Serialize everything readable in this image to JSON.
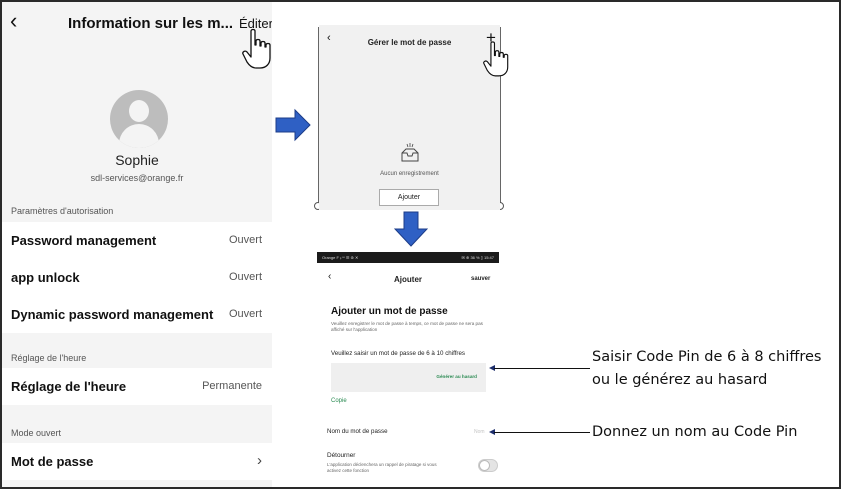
{
  "left_screen": {
    "title": "Information sur les m...",
    "edit_label": "Éditer",
    "user_name": "Sophie",
    "user_email": "sdl-services@orange.fr",
    "sections": [
      {
        "header": "Paramètres d'autorisation"
      },
      {
        "header": "Réglage de l'heure"
      },
      {
        "header": "Mode ouvert"
      }
    ],
    "rows": [
      {
        "label": "Password management",
        "value": "Ouvert"
      },
      {
        "label": "app unlock",
        "value": "Ouvert"
      },
      {
        "label": "Dynamic password management",
        "value": "Ouvert"
      },
      {
        "label": "Réglage de l'heure",
        "value": "Permanente"
      },
      {
        "label": "Mot de passe",
        "value": ""
      }
    ]
  },
  "manage_screen": {
    "title": "Gérer le mot de passe",
    "empty_text": "Aucun enregistrement",
    "add_button": "Ajouter"
  },
  "add_screen": {
    "status_left": "Orange F ᵢₗ ᵚ ☰ ⊛ ✕",
    "status_right": "✉ ⊕ 36 % ▯ 15:47",
    "title": "Ajouter",
    "save_label": "sauver",
    "heading": "Ajouter un mot de passe",
    "description": "Veuillez enregistrer le mot de passe à temps, ce mot de passe ne sera pas affiché sur l'application",
    "input_label": "Veuillez saisir un mot de passe de 6 à 10 chiffres",
    "generate_label": "Générer au hasard",
    "copy_label": "Copie",
    "name_label": "Nom du mot de passe",
    "name_placeholder": "Nom",
    "divert_label": "Détourner",
    "divert_description": "L'application déclenchera un rappel de piratage si vous activez cette fonction"
  },
  "annotations": {
    "pin_line1": "Saisir Code Pin de 6 à 8 chiffres",
    "pin_line2": "ou le générez au hasard",
    "name_text": "Donnez un nom au Code Pin"
  },
  "colors": {
    "arrow": "#2f60c4",
    "accent_green": "#2a8a52"
  }
}
